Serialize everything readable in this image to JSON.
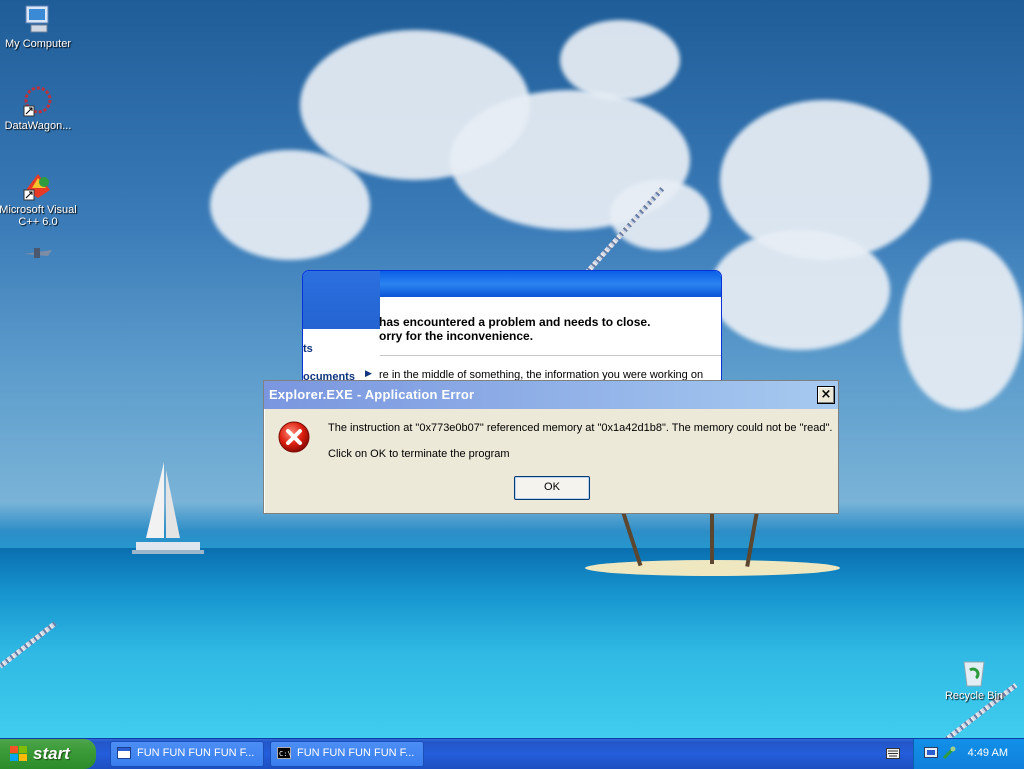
{
  "desktop": {
    "icons": [
      {
        "label": "My Computer",
        "icon": "my-computer-icon"
      },
      {
        "label": "DataWagon...",
        "icon": "datawagon-shortcut-icon"
      },
      {
        "label": "Microsoft Visual C++ 6.0",
        "icon": "visual-cpp-icon"
      },
      {
        "label": "Recycle Bin",
        "icon": "recycle-bin-icon"
      }
    ]
  },
  "bg_window": {
    "message_line1": "has encountered a problem and needs to close.",
    "message_line2": "orry for the inconvenience.",
    "menu_item1": "ts",
    "menu_item2": "ocuments",
    "message_line3": "re in the middle of something, the information you were working on"
  },
  "dialog": {
    "title": "Explorer.EXE - Application Error",
    "close_label": "×",
    "message": "The instruction at \"0x773e0b07\" referenced memory at \"0x1a42d1b8\". The memory could not be \"read\".",
    "hint": "Click on OK to terminate the program",
    "ok_label": "OK",
    "icon": "error-icon"
  },
  "taskbar": {
    "start_label": "start",
    "tasks": [
      {
        "label": "FUN FUN FUN FUN F...",
        "icon": "window-icon"
      },
      {
        "label": "FUN FUN FUN FUN F...",
        "icon": "command-prompt-icon"
      }
    ],
    "clock": "4:49 AM"
  },
  "colors": {
    "taskbar": "#245edb",
    "start": "#3b9b38",
    "dialog_title": "#7a96df",
    "dialog_bg": "#ece9d8"
  }
}
